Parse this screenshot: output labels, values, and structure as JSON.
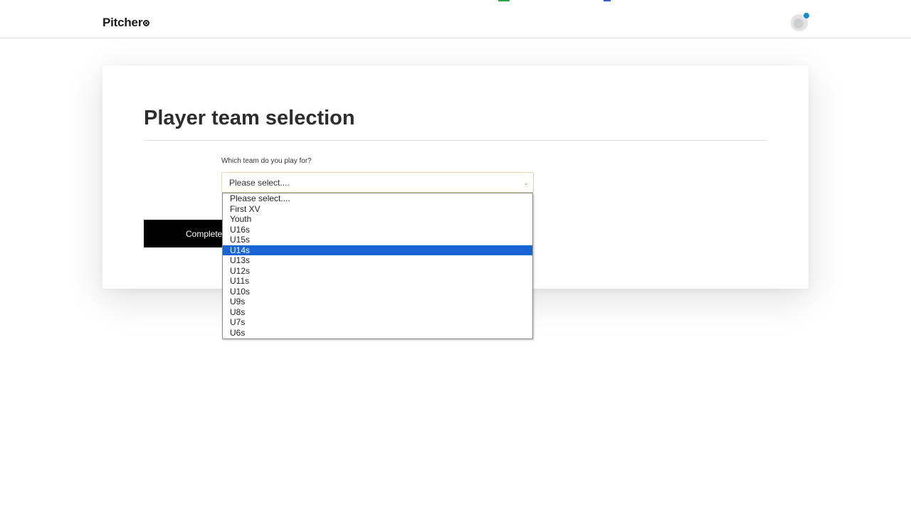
{
  "header": {
    "logo_text": "Pitcher",
    "accent_color": "#0a8fd4"
  },
  "form": {
    "title": "Player team selection",
    "field_label": "Which team do you play for?",
    "select_value": "Please select....",
    "submit_label": "Complete"
  },
  "dropdown": {
    "options": [
      "Please select....",
      "First XV",
      "Youth",
      "U16s",
      "U15s",
      "U14s",
      "U13s",
      "U12s",
      "U11s",
      "U10s",
      "U9s",
      "U8s",
      "U7s",
      "U6s"
    ],
    "highlighted_index": 5,
    "highlight_color": "#1a65d6"
  }
}
